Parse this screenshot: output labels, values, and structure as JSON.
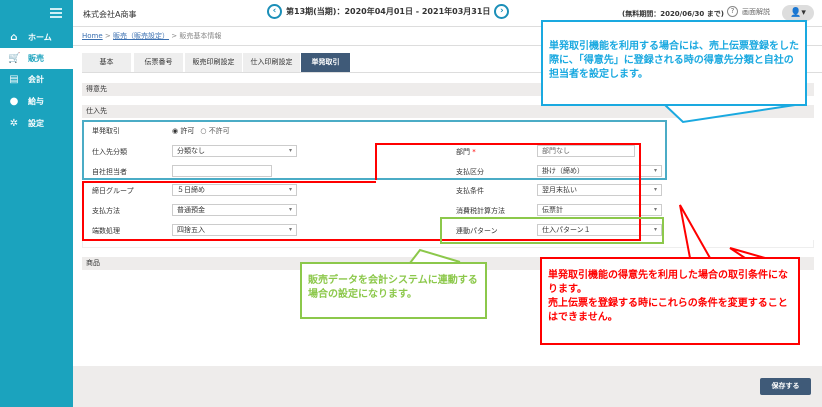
{
  "sidebar": {
    "items": [
      {
        "label": "ホーム",
        "icon": "home-icon"
      },
      {
        "label": "販売",
        "icon": "cart-icon",
        "selected": true
      },
      {
        "label": "会計",
        "icon": "calculator-icon"
      },
      {
        "label": "給与",
        "icon": "money-bag-icon"
      },
      {
        "label": "設定",
        "icon": "gear-icon"
      }
    ]
  },
  "header": {
    "company": "株式会社A商事",
    "period": "第13期(当期)：2020年04月01日 - 2021年03月31日",
    "trial": "(無料期間：2020/06/30 まで)",
    "help": "画面解説",
    "help_icon": "?",
    "user_icon": "👤▾"
  },
  "breadcrumb": {
    "home": "Home",
    "sales": "販売（販売設定）",
    "current": "販売基本情報",
    "sep": ">"
  },
  "tabs": [
    "基本",
    "伝票番号",
    "販売印刷設定",
    "仕入印刷設定",
    "単発取引"
  ],
  "sections": {
    "customer": "得意先",
    "supplier": "仕入先",
    "product": "商品"
  },
  "form": {
    "single_trade": {
      "label": "単発取引",
      "opt1": "許可",
      "opt2": "不許可",
      "selected": "許可"
    },
    "supplier_class": {
      "label": "仕入先分類",
      "value": "分類なし"
    },
    "staff": {
      "label": "自社担当者",
      "value": ""
    },
    "closing_group": {
      "label": "締日グループ",
      "value": "５日締め"
    },
    "pay_method": {
      "label": "支払方法",
      "value": "普通預金"
    },
    "rounding": {
      "label": "端数処理",
      "value": "四捨五入"
    },
    "dept": {
      "label": "部門",
      "required": "*",
      "value": "部門なし"
    },
    "pay_class": {
      "label": "支払区分",
      "value": "掛け（締め）"
    },
    "pay_terms": {
      "label": "支払条件",
      "value": "翌月末払い"
    },
    "tax_calc": {
      "label": "消費税計算方法",
      "value": "伝票計"
    },
    "link_pattern": {
      "label": "連動パターン",
      "value": "仕入パターン１"
    }
  },
  "callouts": {
    "blue": "単発取引機能を利用する場合には、売上伝票登録をした際に、「得意先」に登録される時の得意先分類と自社の担当者を設定します。",
    "green": "販売データを会計システムに連動する場合の設定になります。",
    "red1": "単発取引機能の得意先を利用した場合の取引条件になります。",
    "red2": "売上伝票を登録する時にこれらの条件を変更することはできません。"
  },
  "footer": {
    "save": "保存する"
  },
  "colors": {
    "sidebar": "#1ba3be",
    "tab_active": "#3f5a78",
    "blue": "#1aa9e0",
    "green": "#8cc84b",
    "red": "#ff0000"
  }
}
